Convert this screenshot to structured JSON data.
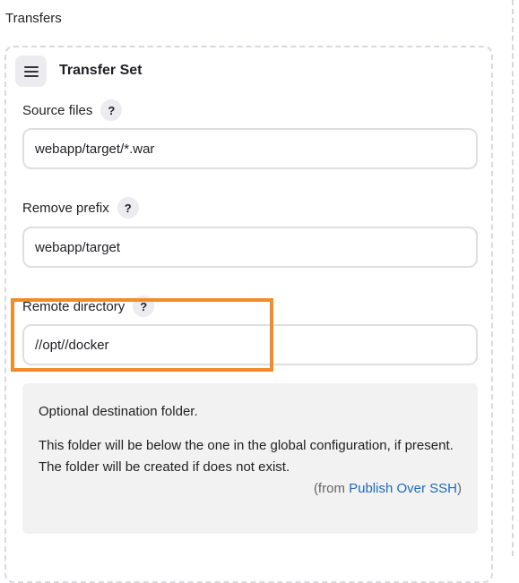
{
  "section": {
    "title": "Transfers"
  },
  "transfer_set": {
    "title": "Transfer Set",
    "handle_icon": "drag-handle-icon"
  },
  "fields": {
    "source_files": {
      "label": "Source files",
      "help": "?",
      "value": "webapp/target/*.war"
    },
    "remove_prefix": {
      "label": "Remove prefix",
      "help": "?",
      "value": "webapp/target"
    },
    "remote_directory": {
      "label": "Remote directory",
      "help": "?",
      "value": "//opt//docker"
    }
  },
  "help_text": {
    "line1": "Optional destination folder.",
    "line2": "This folder will be below the one in the global configuration, if present.",
    "line3": "The folder will be created if does not exist.",
    "from_prefix": "(from ",
    "from_link": "Publish Over SSH",
    "from_suffix": ")"
  },
  "colors": {
    "highlight": "#f28c28",
    "link": "#1e6bb8"
  }
}
